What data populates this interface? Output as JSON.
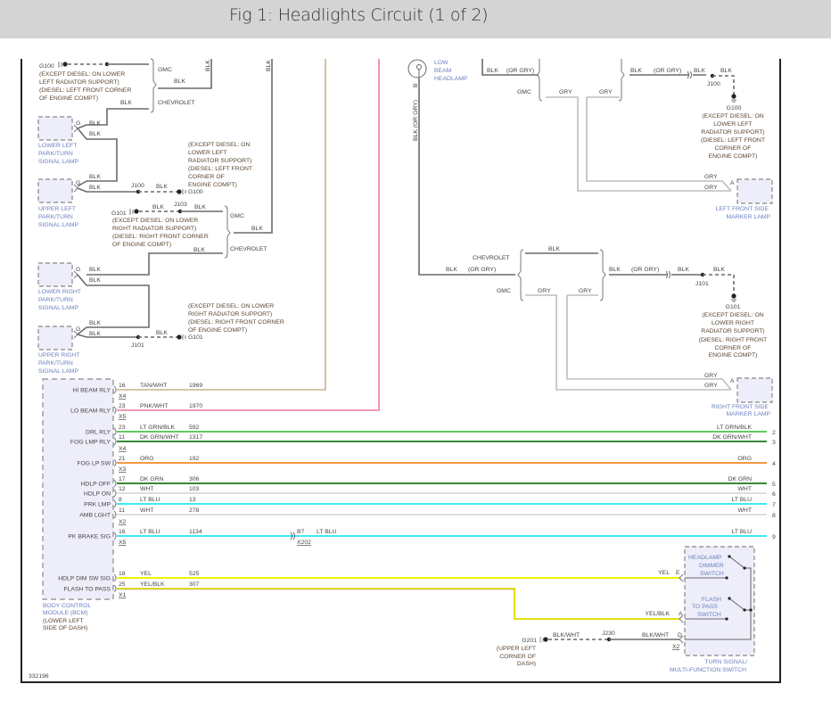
{
  "title": "Fig 1: Headlights Circuit (1 of 2)",
  "diagram_id": "332196",
  "colors": {
    "tan_wht": "#c8b48a",
    "pnk_wht": "#f07a98",
    "lt_grn_blk": "#4cc24c",
    "dk_grn_wht": "#1a7a1a",
    "org": "#f08a28",
    "dk_grn": "#1a7a1a",
    "wht": "#dadada",
    "lt_blu": "#22e6f2",
    "yel": "#f4f000",
    "yel_blk": "#e6de10",
    "blk": "#6a6a6a",
    "gry": "#bdbdbd",
    "component_label": "#6b80c2",
    "location_note": "#5a4632"
  },
  "common": {
    "blk": "BLK",
    "gry": "GRY",
    "or_gry": "(OR GRY)",
    "gmc": "GMC",
    "chevrolet": "CHEVROLET",
    "g": "G",
    "a": "A",
    "b": "B",
    "blk_or_gry_vertical": "BLK    (OR GRY)"
  },
  "grounds": {
    "g100": "G100",
    "g101": "G101",
    "g201": "G201"
  },
  "junctions": {
    "j100": "J100",
    "j101": "J101",
    "j103": "J103",
    "j230": "J230"
  },
  "notes": {
    "g100_top": [
      "(EXCEPT DIESEL: ON LOWER",
      "LEFT RADIATOR SUPPORT)",
      "(DIESEL: LEFT FRONT CORNER",
      "OF ENGINE COMPT)"
    ],
    "g100_mid": [
      "(EXCEPT DIESEL: ON",
      "LOWER LEFT",
      "RADIATOR SUPPORT)",
      "(DIESEL: LEFT FRONT",
      "CORNER OF",
      "ENGINE COMPT)"
    ],
    "g101_mid": [
      "(EXCEPT DIESEL: ON LOWER",
      "RIGHT RADIATOR SUPPORT)",
      "(DIESEL: RIGHT FRONT CORNER",
      "OF ENGINE COMPT)"
    ],
    "g101_low": [
      "(EXCEPT DIESEL: ON LOWER",
      "RIGHT RADIATOR SUPPORT)",
      "(DIESEL: RIGHT FRONT CORNER",
      "OF ENGINE COMPT)"
    ],
    "g100_right": [
      "(EXCEPT DIESEL: ON",
      "LOWER LEFT",
      "RADIATOR SUPPORT)",
      "(DIESEL: LEFT FRONT",
      "CORNER OF",
      "ENGINE COMPT)"
    ],
    "g101_right": [
      "(EXCEPT DIESEL: ON",
      "LOWER RIGHT",
      "RADIATOR SUPPORT)",
      "(DIESEL: RIGHT FRONT",
      "CORNER OF",
      "ENGINE COMPT)"
    ],
    "g201": [
      "(UPPER LEFT",
      "CORNER OF",
      "DASH)"
    ]
  },
  "lamps": {
    "lower_left": [
      "LOWER LEFT",
      "PARK/TURN",
      "SIGNAL LAMP"
    ],
    "upper_left": [
      "UPPER LEFT",
      "PARK/TURN",
      "SIGNAL LAMP"
    ],
    "lower_right": [
      "LOWER RIGHT",
      "PARK/TURN",
      "SIGNAL LAMP"
    ],
    "upper_right": [
      "UPPER RIGHT",
      "PARK/TURN",
      "SIGNAL LAMP"
    ],
    "low_beam": [
      "LOW",
      "BEAM",
      "HEADLAMP"
    ],
    "left_marker": [
      "LEFT FRONT SIDE",
      "MARKER LAMP"
    ],
    "right_marker": [
      "RIGHT FRONT SIDE",
      "MARKER LAMP"
    ]
  },
  "bcm": {
    "name": [
      "BODY CONTROL",
      "MODULE (BCM)"
    ],
    "location": [
      "(LOWER LEFT",
      "SIDE OF DASH)"
    ],
    "circuits": [
      {
        "label": "HI BEAM RLY",
        "pin": "16",
        "wire": "TAN/WHT",
        "circuit": "1969",
        "connector": "X4"
      },
      {
        "label": "LO BEAM RLY",
        "pin": "23",
        "wire": "PNK/WHT",
        "circuit": "1970",
        "connector": "X5"
      },
      {
        "label": "DRL RLY",
        "pin": "23",
        "wire": "LT GRN/BLK",
        "circuit": "592",
        "end": "2"
      },
      {
        "label": "FOG LMP RLY",
        "pin": "11",
        "wire": "DK GRN/WHT",
        "circuit": "1317",
        "connector": "X4",
        "end": "3"
      },
      {
        "label": "FOG LP SW",
        "pin": "21",
        "wire": "ORG",
        "circuit": "192",
        "connector": "X3",
        "end": "4"
      },
      {
        "label": "HDLP OFF",
        "pin": "17",
        "wire": "DK GRN",
        "circuit": "306",
        "end": "5"
      },
      {
        "label": "HDLP ON",
        "pin": "12",
        "wire": "WHT",
        "circuit": "103",
        "end": "6"
      },
      {
        "label": "PRK LMP",
        "pin": "8",
        "wire": "LT BLU",
        "circuit": "13",
        "end": "7"
      },
      {
        "label": "AMB LGHT",
        "pin": "11",
        "wire": "WHT",
        "circuit": "278",
        "connector": "X2",
        "end": "8"
      },
      {
        "label": "PK BRAKE SIG",
        "pin": "16",
        "wire": "LT BLU",
        "circuit": "1134",
        "connector": "X5",
        "end": "9",
        "inline_pin": "B7",
        "inline_connector": "X202"
      },
      {
        "label": "HDLP DIM SW SIG",
        "pin": "18",
        "wire": "YEL",
        "circuit": "525"
      },
      {
        "label": "FLASH TO PASS",
        "pin": "25",
        "wire": "YEL/BLK",
        "circuit": "307",
        "connector": "X1"
      }
    ]
  },
  "switch": {
    "name": [
      "TURN SIGNAL/",
      "MULTI-FUNCTION SWITCH"
    ],
    "dimmer": [
      "HEADLAMP",
      "DIMMER",
      "SWITCH"
    ],
    "flash": [
      "FLASH",
      "TO PASS",
      "SWITCH"
    ],
    "pins": {
      "e": "E",
      "a": "A",
      "d": "D",
      "connector": "X2"
    },
    "wires": {
      "yel": "YEL",
      "yel_blk": "YEL/BLK",
      "blk_wht": "BLK/WHT"
    }
  }
}
